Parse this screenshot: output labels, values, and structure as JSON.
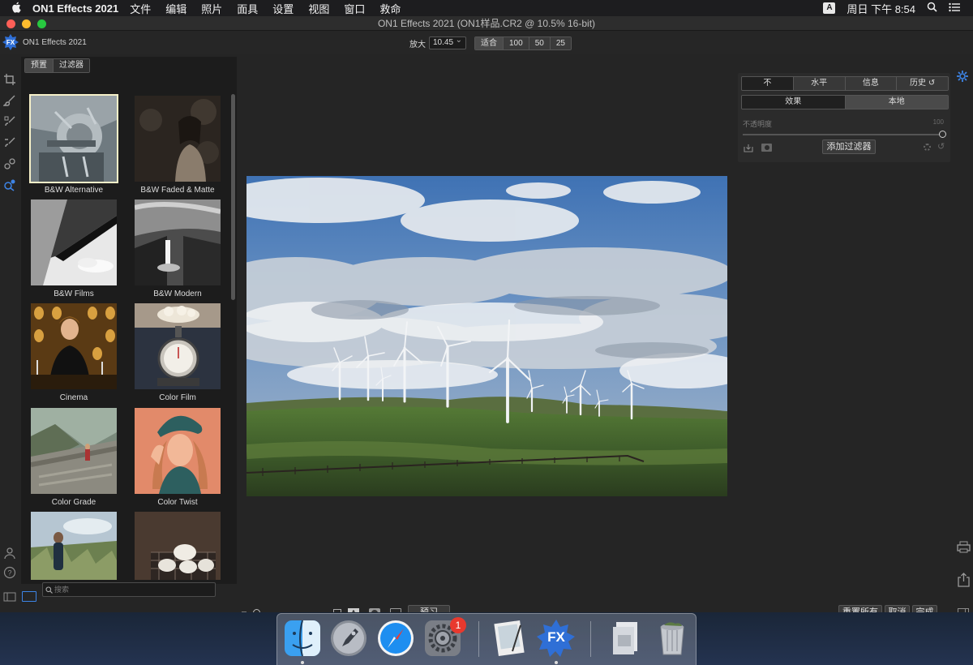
{
  "menubar": {
    "app_name": "ON1 Effects 2021",
    "items": [
      "文件",
      "编辑",
      "照片",
      "面具",
      "设置",
      "视图",
      "窗口",
      "救命"
    ],
    "input_indicator": "A",
    "clock": "周日 下午 8:54"
  },
  "window": {
    "title": "ON1 Effects 2021 (ON1样品.CR2 @ 10.5% 16-bit)",
    "app_label": "ON1 Effects 2021"
  },
  "toolbar": {
    "zoom_label": "放大",
    "zoom_value": "10.45",
    "zoom_buttons": [
      "适合",
      "100",
      "50",
      "25"
    ]
  },
  "browser": {
    "tabs": [
      "预置",
      "过滤器"
    ],
    "presets": [
      {
        "label": "B&W Alternative"
      },
      {
        "label": "B&W Faded & Matte"
      },
      {
        "label": "B&W Films"
      },
      {
        "label": "B&W Modern"
      },
      {
        "label": "Cinema"
      },
      {
        "label": "Color Film"
      },
      {
        "label": "Color Grade"
      },
      {
        "label": "Color Twist"
      }
    ],
    "search_placeholder": "搜索"
  },
  "right_panel": {
    "view_tabs": [
      "不",
      "水平",
      "信息",
      "历史"
    ],
    "mode_tabs": [
      "效果",
      "本地"
    ],
    "opacity_label": "不透明度",
    "opacity_value": "100",
    "add_filter_label": "添加过滤器"
  },
  "bottom": {
    "preview_label": "预习",
    "view_a_label": "A",
    "reset_all_label": "重置所有",
    "cancel_label": "取消",
    "done_label": "完成"
  },
  "dock": {
    "settings_badge": "1",
    "fx_icon_text": "FX"
  },
  "colors": {
    "accent": "#3d84e6",
    "selected_thumb_border": "#f6f0c8",
    "panel_bg": "#252525"
  }
}
